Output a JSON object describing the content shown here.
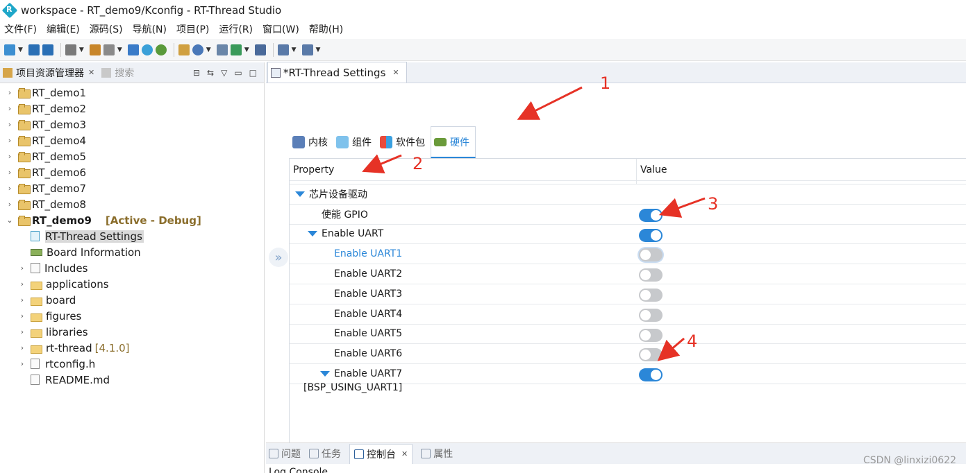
{
  "window": {
    "title": "workspace - RT_demo9/Kconfig - RT-Thread Studio"
  },
  "menubar": [
    "文件(F)",
    "编辑(E)",
    "源码(S)",
    "导航(N)",
    "项目(P)",
    "运行(R)",
    "窗口(W)",
    "帮助(H)"
  ],
  "left_panel": {
    "tab_label": "项目资源管理器",
    "search_label": "搜索",
    "projects": [
      "RT_demo1",
      "RT_demo2",
      "RT_demo3",
      "RT_demo4",
      "RT_demo5",
      "RT_demo6",
      "RT_demo7",
      "RT_demo8"
    ],
    "active_project": {
      "name": "RT_demo9",
      "tag": "[Active - Debug]"
    },
    "children": {
      "settings": "RT-Thread Settings",
      "board_info": "Board Information",
      "includes": "Includes",
      "applications": "applications",
      "board": "board",
      "figures": "figures",
      "libraries": "libraries",
      "rt_thread": "rt-thread",
      "rt_thread_version": "[4.1.0]",
      "rtconfig": "rtconfig.h",
      "readme": "README.md"
    }
  },
  "editor": {
    "tab_label": "*RT-Thread Settings",
    "tabs": [
      "内核",
      "组件",
      "软件包",
      "硬件"
    ],
    "active_tab": "硬件",
    "columns": {
      "property": "Property",
      "value": "Value"
    },
    "rows": {
      "section": "芯片设备驱动",
      "gpio": "使能 GPIO",
      "uart_group": "Enable UART",
      "uart1": "Enable UART1",
      "uart2": "Enable UART2",
      "uart3": "Enable UART3",
      "uart4": "Enable UART4",
      "uart5": "Enable UART5",
      "uart6": "Enable UART6",
      "uart7": "Enable UART7"
    },
    "toggles": {
      "gpio": true,
      "uart_group": true,
      "uart1": false,
      "uart2": false,
      "uart3": false,
      "uart4": false,
      "uart5": false,
      "uart6": false,
      "uart7": true
    },
    "description": "[BSP_USING_UART1]"
  },
  "bottom_panel": {
    "tabs": [
      "问题",
      "任务",
      "控制台",
      "属性"
    ],
    "active_tab": "控制台",
    "console_title": "Log Console"
  },
  "annotations": [
    "1",
    "2",
    "3",
    "4"
  ],
  "watermark": "CSDN @linxizi0622",
  "colors": {
    "accent": "#2b87d8",
    "arrow": "#e63226",
    "active_tag": "#8a6d2b"
  }
}
